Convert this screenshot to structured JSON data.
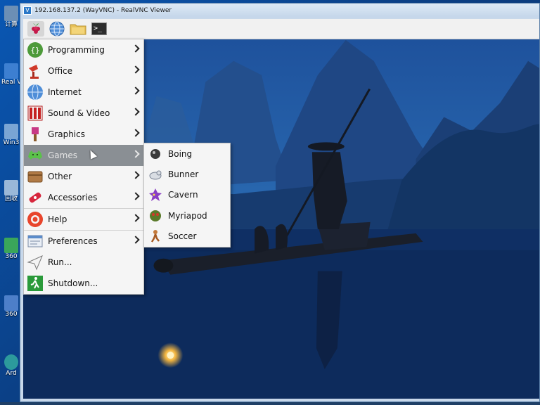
{
  "host": {
    "desktop_icons": [
      {
        "label": "计算",
        "color": "#6c8fb5"
      },
      {
        "label": "Real Vie",
        "color": "#3d7fd1"
      },
      {
        "label": "Win3",
        "color": "#7aa5d4"
      },
      {
        "label": "回收",
        "color": "#9ab8d8"
      },
      {
        "label": "360",
        "color": "#3aa65a"
      },
      {
        "label": "360",
        "color": "#4d7fc9"
      },
      {
        "label": "Ard",
        "color": "#2c9a9c"
      }
    ]
  },
  "window": {
    "title": "192.168.137.2 (WayVNC) - RealVNC Viewer",
    "app_icon": "vnc-icon"
  },
  "panel": {
    "buttons": [
      {
        "name": "raspberry-menu-button",
        "icon": "raspberry-icon"
      },
      {
        "name": "browser-button",
        "icon": "globe-icon"
      },
      {
        "name": "file-manager-button",
        "icon": "folder-icon"
      },
      {
        "name": "terminal-button",
        "icon": "terminal-icon",
        "text": ">_"
      }
    ]
  },
  "menu": {
    "items": [
      {
        "label": "Programming",
        "icon": "programming-icon",
        "has_submenu": true
      },
      {
        "label": "Office",
        "icon": "office-icon",
        "has_submenu": true
      },
      {
        "label": "Internet",
        "icon": "internet-icon",
        "has_submenu": true
      },
      {
        "label": "Sound & Video",
        "icon": "sound-video-icon",
        "has_submenu": true
      },
      {
        "label": "Graphics",
        "icon": "graphics-icon",
        "has_submenu": true
      },
      {
        "label": "Games",
        "icon": "games-icon",
        "has_submenu": true,
        "highlighted": true
      },
      {
        "label": "Other",
        "icon": "other-icon",
        "has_submenu": true
      },
      {
        "label": "Accessories",
        "icon": "accessories-icon",
        "has_submenu": true
      },
      {
        "label": "Help",
        "icon": "help-icon",
        "has_submenu": true
      },
      {
        "label": "Preferences",
        "icon": "preferences-icon",
        "has_submenu": true
      },
      {
        "label": "Run...",
        "icon": "run-icon",
        "has_submenu": false
      },
      {
        "label": "Shutdown...",
        "icon": "shutdown-icon",
        "has_submenu": false
      }
    ]
  },
  "games_submenu": {
    "items": [
      {
        "label": "Boing",
        "icon": "boing-icon"
      },
      {
        "label": "Bunner",
        "icon": "bunner-icon"
      },
      {
        "label": "Cavern",
        "icon": "cavern-icon"
      },
      {
        "label": "Myriapod",
        "icon": "myriapod-icon"
      },
      {
        "label": "Soccer",
        "icon": "soccer-icon"
      }
    ]
  },
  "colors": {
    "menu_highlight": "#8a8f94",
    "wallpaper_sky": "#1d4f9a",
    "wallpaper_water": "#0d2f66"
  }
}
